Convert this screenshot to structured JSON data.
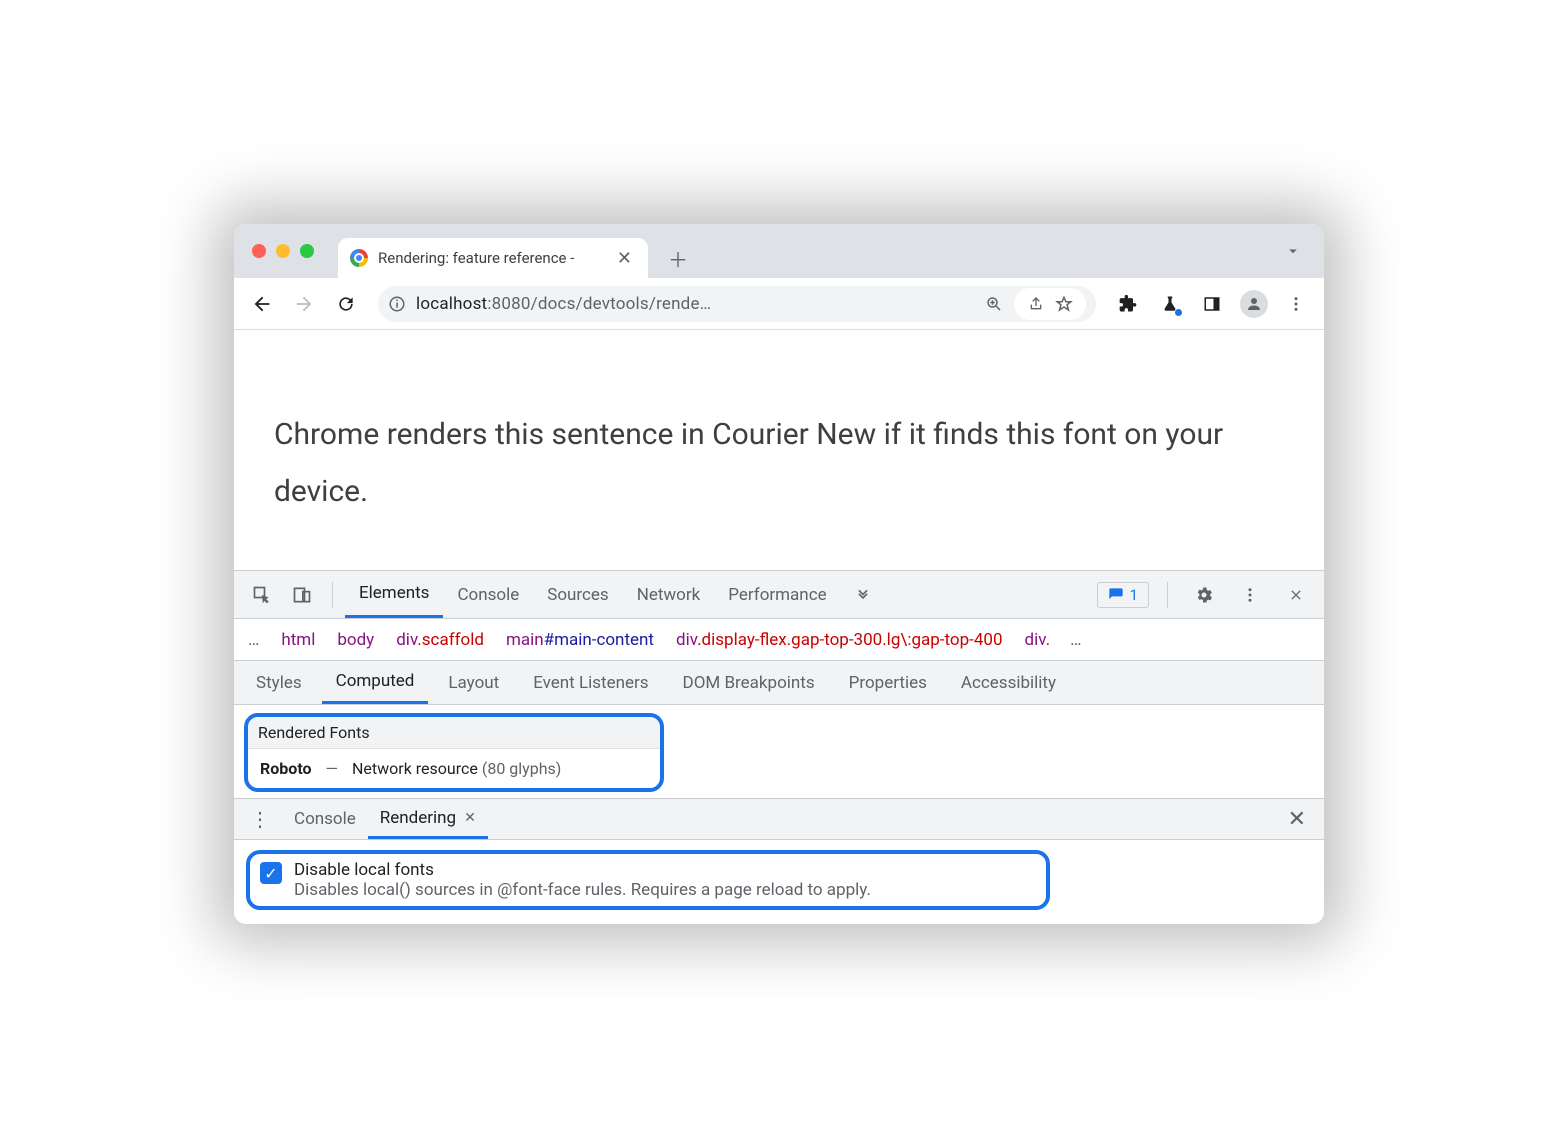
{
  "browser": {
    "tab_title": "Rendering: feature reference -",
    "url_host": "localhost",
    "url_rest": ":8080/docs/devtools/rende…"
  },
  "page": {
    "sentence": "Chrome renders this sentence in Courier New if it finds this font on your device."
  },
  "devtools": {
    "top_tabs": [
      "Elements",
      "Console",
      "Sources",
      "Network",
      "Performance"
    ],
    "top_active": "Elements",
    "issues_count": "1",
    "breadcrumb": [
      {
        "tag": "html",
        "cls": "",
        "id": ""
      },
      {
        "tag": "body",
        "cls": "",
        "id": ""
      },
      {
        "tag": "div",
        "cls": ".scaffold",
        "id": ""
      },
      {
        "tag": "main",
        "cls": "",
        "id": "#main-content"
      },
      {
        "tag": "div",
        "cls": ".display-flex.gap-top-300.lg\\:gap-top-400",
        "id": ""
      },
      {
        "tag": "div",
        "cls": ".",
        "id": ""
      }
    ],
    "sub_tabs": [
      "Styles",
      "Computed",
      "Layout",
      "Event Listeners",
      "DOM Breakpoints",
      "Properties",
      "Accessibility"
    ],
    "sub_active": "Computed",
    "rendered_fonts": {
      "heading": "Rendered Fonts",
      "family": "Roboto",
      "source": "Network resource",
      "count": "(80 glyphs)"
    },
    "drawer": {
      "tabs": [
        "Console",
        "Rendering"
      ],
      "active": "Rendering",
      "disable_title": "Disable local fonts",
      "disable_desc": "Disables local() sources in @font-face rules. Requires a page reload to apply."
    }
  }
}
